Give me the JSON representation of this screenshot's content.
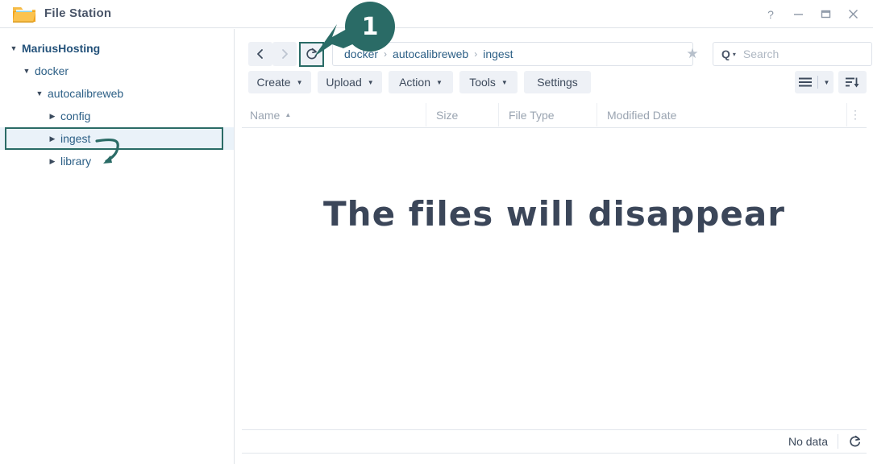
{
  "window": {
    "title": "File Station",
    "icon": "folder-icon",
    "controls": [
      {
        "name": "help-button",
        "glyph": "?"
      },
      {
        "name": "minimize-button",
        "glyph": "—"
      },
      {
        "name": "maximize-button",
        "glyph": "❐"
      },
      {
        "name": "close-button",
        "glyph": "✕"
      }
    ]
  },
  "sidebar": {
    "items": [
      {
        "label": "MariusHosting",
        "level": 0,
        "expanded": true,
        "caret": "▼"
      },
      {
        "label": "docker",
        "level": 1,
        "expanded": true,
        "caret": "▼"
      },
      {
        "label": "autocalibreweb",
        "level": 2,
        "expanded": true,
        "caret": "▼"
      },
      {
        "label": "config",
        "level": 3,
        "expanded": false,
        "caret": "▶"
      },
      {
        "label": "ingest",
        "level": 3,
        "expanded": false,
        "caret": "▶"
      },
      {
        "label": "library",
        "level": 3,
        "expanded": false,
        "caret": "▶"
      }
    ],
    "selected": "ingest"
  },
  "nav": {
    "back": "‹",
    "forward": "›",
    "refresh": "⟳"
  },
  "breadcrumb": {
    "segments": [
      "docker",
      "autocalibreweb",
      "ingest"
    ],
    "separator": "›",
    "star": "★"
  },
  "search": {
    "glyph": "Q",
    "caret": "▾",
    "placeholder": "Search",
    "value": ""
  },
  "toolbar": {
    "buttons": [
      {
        "label": "Create",
        "dropdown": true
      },
      {
        "label": "Upload",
        "dropdown": true
      },
      {
        "label": "Action",
        "dropdown": true
      },
      {
        "label": "Tools",
        "dropdown": true
      },
      {
        "label": "Settings",
        "dropdown": false
      }
    ],
    "view_icon": "list-view-icon",
    "view_caret": "▾",
    "sort_icon": "sort-descending-icon"
  },
  "table": {
    "columns": [
      {
        "label": "Name",
        "sorted": true,
        "sort_caret": "▲"
      },
      {
        "label": "Size",
        "sorted": false
      },
      {
        "label": "File Type",
        "sorted": false
      },
      {
        "label": "Modified Date",
        "sorted": false
      }
    ],
    "kebab": "⋮",
    "rows": [],
    "empty_message": "The files will disappear"
  },
  "status": {
    "text": "No data",
    "refresh_icon": "⟳"
  },
  "annotations": {
    "step_badge": "1",
    "accent_color": "#2a6b66",
    "arrow_to_refresh": "arrow-pointing-at-refresh-button",
    "arrow_to_library": "curved-arrow-ingest-to-library",
    "highlight_refresh": "refresh-button-highlight",
    "highlight_ingest": "ingest-row-highlight"
  }
}
